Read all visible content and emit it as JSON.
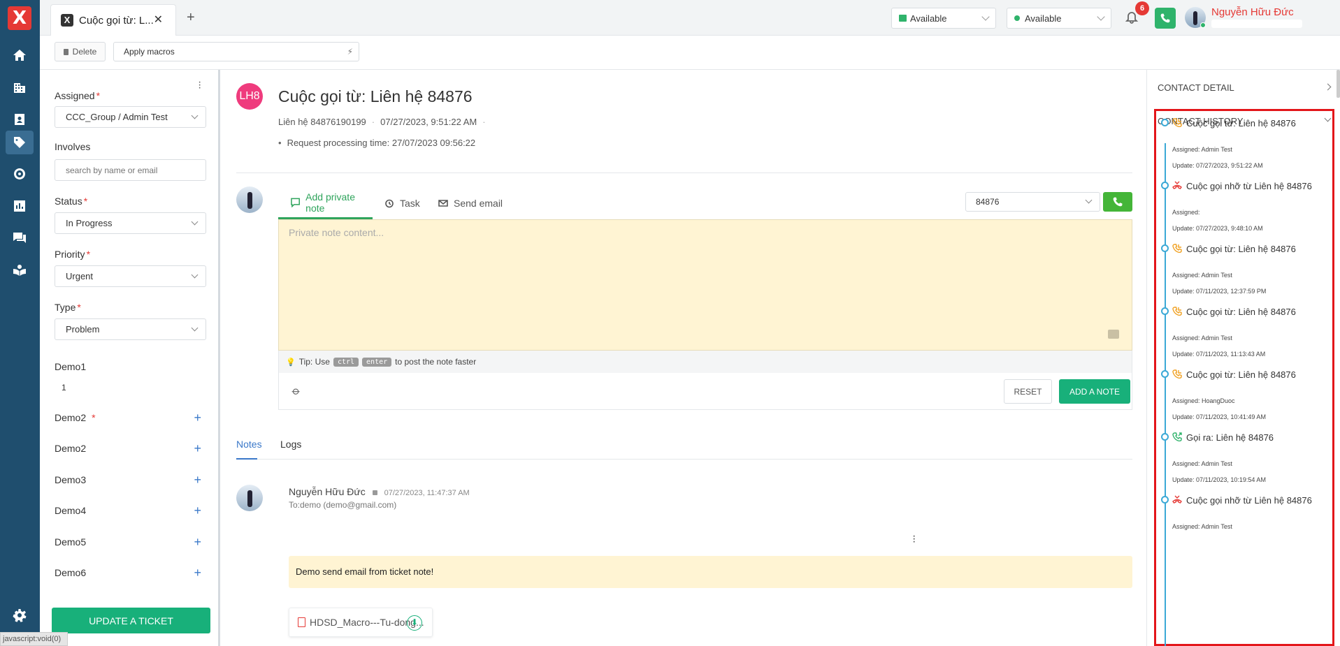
{
  "nav": {
    "logo": "X",
    "items": [
      "home-icon",
      "building-icon",
      "contact-card-icon",
      "ticket-tag-icon",
      "target-icon",
      "chart-icon",
      "chat-icon",
      "book-icon",
      "settings-icon"
    ]
  },
  "topbar": {
    "tab_label": "Cuộc gọi từ: L...",
    "tab_logo": "X",
    "status1": "Available",
    "status2": "Available",
    "notification_count": "6",
    "user_name": "Nguyễn Hữu Đức"
  },
  "toolbar": {
    "delete_label": "Delete",
    "macro_placeholder": "Apply macros"
  },
  "form": {
    "assigned_label": "Assigned",
    "assigned_value": "CCC_Group / Admin Test",
    "involves_label": "Involves",
    "involves_placeholder": "search by name or email",
    "status_label": "Status",
    "status_value": "In Progress",
    "priority_label": "Priority",
    "priority_value": "Urgent",
    "type_label": "Type",
    "type_value": "Problem",
    "demo1_label": "Demo1",
    "demo1_value": "1",
    "demo_fields": [
      "Demo2",
      "Demo2",
      "Demo3",
      "Demo4",
      "Demo5",
      "Demo6"
    ],
    "required_mark": "*",
    "update_label": "UPDATE A TICKET"
  },
  "statusbar": "javascript:void(0)",
  "ticket": {
    "avatar_initials": "LH8",
    "title": "Cuộc gọi từ: Liên hệ 84876",
    "contact": "Liên hệ 84876190199",
    "datetime": "07/27/2023, 9:51:22 AM",
    "processing_time": "Request processing time: 27/07/2023 09:56:22"
  },
  "composer": {
    "tabs": [
      "Add private note",
      "Task",
      "Send email"
    ],
    "phone_value": "84876",
    "placeholder": "Private note content...",
    "tip_prefix": "Tip: Use",
    "tip_key1": "ctrl",
    "tip_key2": "enter",
    "tip_suffix": "to post the note faster",
    "reset_label": "RESET",
    "add_note_label": "ADD A NOTE"
  },
  "log_tabs": [
    "Notes",
    "Logs"
  ],
  "note_entry": {
    "author": "Nguyễn Hữu Đức",
    "time": "07/27/2023, 11:47:37 AM",
    "to": "To:demo (demo@gmail.com)",
    "body": "Demo send email from ticket note!",
    "attachment": "HDSD_Macro---Tu-dong..."
  },
  "right_panel": {
    "contact_detail": "CONTACT DETAIL",
    "contact_history": "CONTACT HISTORY",
    "history": [
      {
        "icon": "incoming-call-icon",
        "color": "#f0a020",
        "title": "Cuộc gọi từ: Liên hệ 84876",
        "assigned": "Assigned: Admin Test",
        "update": "Update: 07/27/2023, 9:51:22 AM"
      },
      {
        "icon": "missed-call-icon",
        "color": "#e53935",
        "title": "Cuộc gọi nhỡ từ Liên hệ 84876",
        "assigned": "Assigned:",
        "update": "Update: 07/27/2023, 9:48:10 AM"
      },
      {
        "icon": "incoming-call-icon",
        "color": "#f0a020",
        "title": "Cuộc gọi từ: Liên hệ 84876",
        "assigned": "Assigned: Admin Test",
        "update": "Update: 07/11/2023, 12:37:59 PM"
      },
      {
        "icon": "incoming-call-icon",
        "color": "#f0a020",
        "title": "Cuộc gọi từ: Liên hệ 84876",
        "assigned": "Assigned: Admin Test",
        "update": "Update: 07/11/2023, 11:13:43 AM"
      },
      {
        "icon": "incoming-call-icon",
        "color": "#f0a020",
        "title": "Cuộc gọi từ: Liên hệ 84876",
        "assigned": "Assigned: HoangDuoc",
        "update": "Update: 07/11/2023, 10:41:49 AM"
      },
      {
        "icon": "outgoing-call-icon",
        "color": "#2fb36b",
        "title": "Gọi ra: Liên hệ 84876",
        "assigned": "Assigned: Admin Test",
        "update": "Update: 07/11/2023, 10:19:54 AM"
      },
      {
        "icon": "missed-call-icon",
        "color": "#e53935",
        "title": "Cuộc gọi nhỡ từ Liên hệ 84876",
        "assigned": "Assigned: Admin Test",
        "update": ""
      }
    ]
  }
}
